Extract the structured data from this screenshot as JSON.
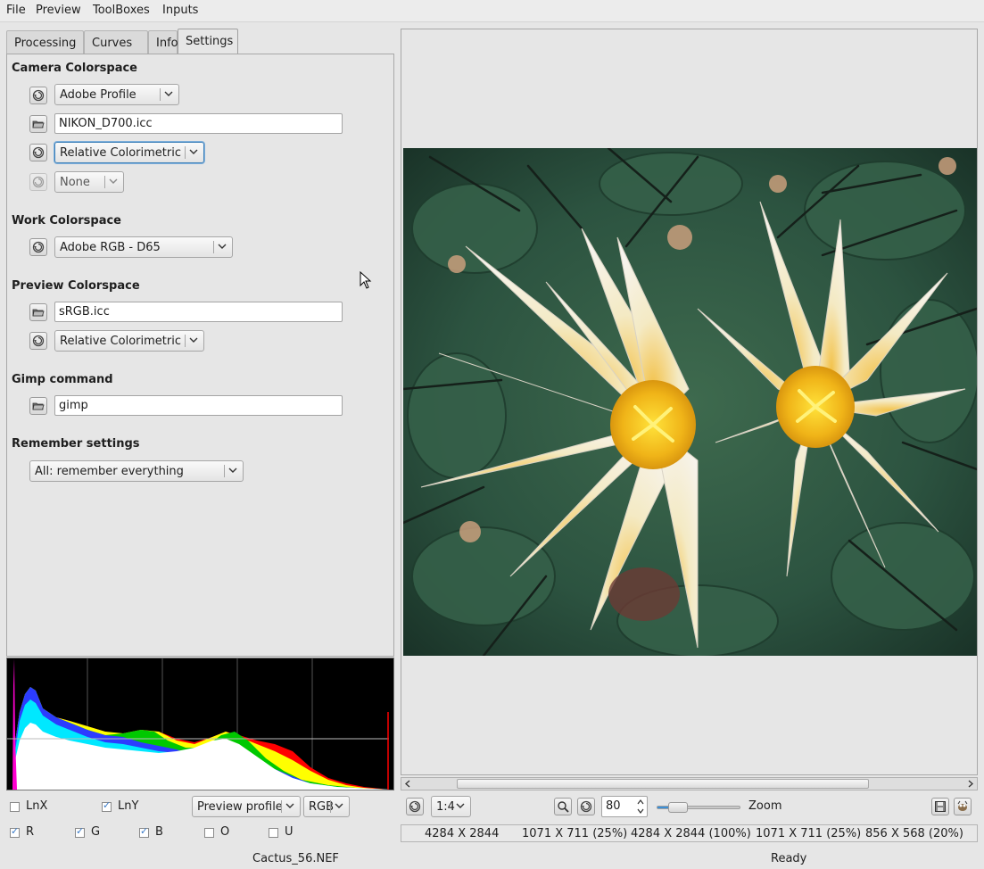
{
  "menu": [
    "File",
    "Preview",
    "ToolBoxes",
    "Inputs"
  ],
  "tabs": [
    "Processing",
    "Curves",
    "Info",
    "Settings"
  ],
  "active_tab": "Settings",
  "settings": {
    "camera_colorspace": {
      "title": "Camera Colorspace",
      "profile_combo": "Adobe Profile",
      "profile_file": "NIKON_D700.icc",
      "intent_combo": "Relative Colorimetric",
      "extra_combo": "None"
    },
    "work_colorspace": {
      "title": "Work Colorspace",
      "combo": "Adobe RGB - D65"
    },
    "preview_colorspace": {
      "title": "Preview Colorspace",
      "file": "sRGB.icc",
      "intent_combo": "Relative Colorimetric"
    },
    "gimp": {
      "title": "Gimp command",
      "command": "gimp"
    },
    "remember": {
      "title": "Remember settings",
      "combo": "All: remember everything"
    }
  },
  "histogram": {
    "options": [
      {
        "label": "LnX",
        "checked": false
      },
      {
        "label": "LnY",
        "checked": true
      },
      {
        "label": "R",
        "checked": true
      },
      {
        "label": "G",
        "checked": true
      },
      {
        "label": "B",
        "checked": true
      },
      {
        "label": "O",
        "checked": false
      },
      {
        "label": "U",
        "checked": false
      }
    ],
    "profile_combo": "Preview profile",
    "channel_combo": "RGB"
  },
  "zoom": {
    "scale_combo": "1:4",
    "value": "80",
    "label": "Zoom",
    "slider_fraction": 0.25
  },
  "sizes": [
    "4284 X 2844",
    "1071 X 711 (25%)",
    "4284 X 2844 (100%)",
    "1071 X 711 (25%)",
    "856 X 568 (20%)"
  ],
  "status": {
    "filename": "Cactus_56.NEF",
    "state": "Ready"
  },
  "colors": {
    "focus_border": "#3c7fb8",
    "histogram_bg": "#000000",
    "check": "#3a7bc8"
  }
}
